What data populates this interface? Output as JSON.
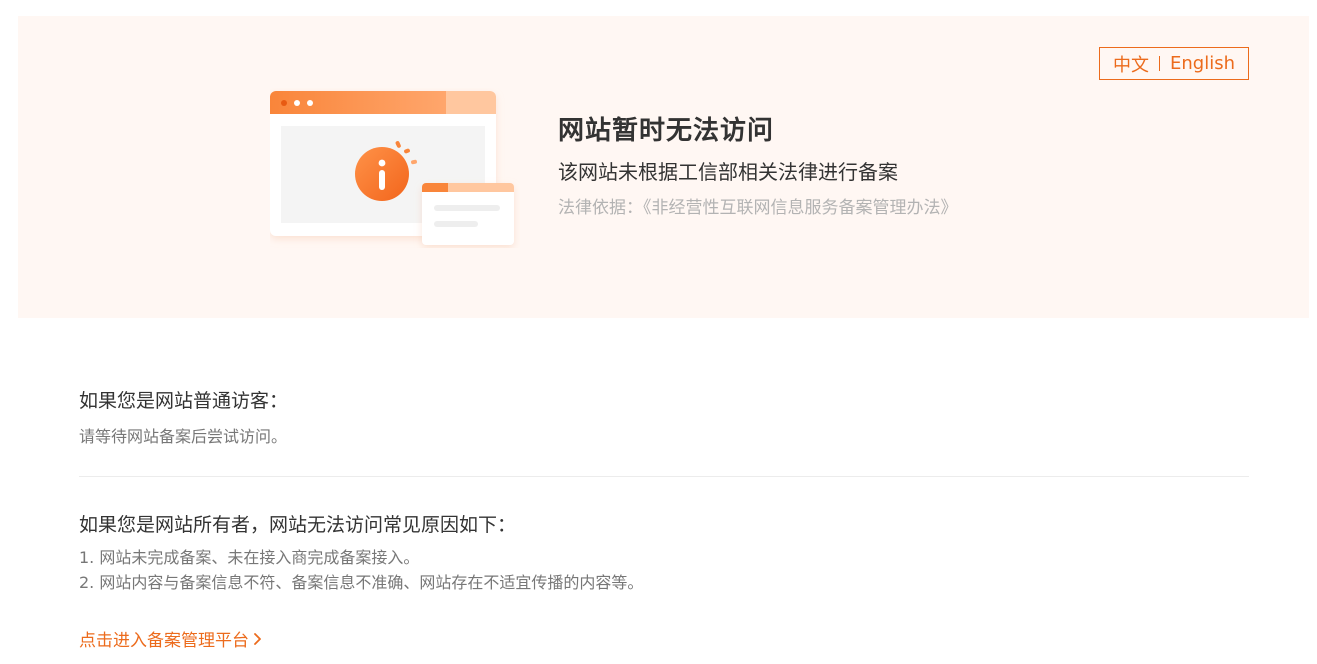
{
  "lang_switch": {
    "zh": "中文",
    "en": "English"
  },
  "banner": {
    "headline": "网站暂时无法访问",
    "subline": "该网站未根据工信部相关法律进行备案",
    "legal_basis": "法律依据：《非经营性互联网信息服务备案管理办法》"
  },
  "visitor_section": {
    "title": "如果您是网站普通访客：",
    "text": "请等待网站备案后尝试访问。"
  },
  "owner_section": {
    "title": "如果您是网站所有者，网站无法访问常见原因如下：",
    "items": [
      "1. 网站未完成备案、未在接入商完成备案接入。",
      "2. 网站内容与备案信息不符、备案信息不准确、网站存在不适宜传播的内容等。"
    ]
  },
  "cta": {
    "label": "点击进入备案管理平台"
  },
  "colors": {
    "accent": "#ec6b1c",
    "banner_bg": "#fff7f3"
  }
}
